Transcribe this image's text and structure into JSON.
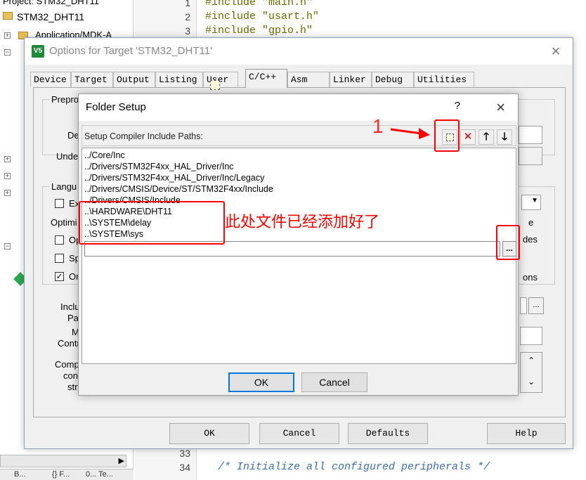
{
  "project": {
    "title": "Project: STM32_DHT11",
    "root": "STM32_DHT11",
    "group": "Application/MDK-A"
  },
  "editor": {
    "lines": [
      {
        "n": "1",
        "text": "#include \"main.h\""
      },
      {
        "n": "2",
        "text": "#include \"usart.h\""
      },
      {
        "n": "3",
        "text": "#include \"gpio.h\""
      }
    ],
    "bottom_lines": [
      {
        "n": "33",
        "text": ""
      },
      {
        "n": "34",
        "text": "  /* Initialize all configured peripherals */"
      }
    ]
  },
  "bottom_tabs": [
    "B...",
    "{} F...",
    "0... Te..."
  ],
  "options_dialog": {
    "icon": "V5",
    "title": "Options for Target 'STM32_DHT11'",
    "close": "×",
    "tabs": [
      "Device",
      "Target",
      "Output",
      "Listing",
      "User",
      "C/C++",
      "Asm",
      "Linker",
      "Debug",
      "Utilities"
    ],
    "active_tab": "C/C++",
    "bg_labels": {
      "preproc": "Prepro",
      "define": "Def",
      "undefine": "Undef",
      "language": "Langu",
      "ex": "Ex",
      "optim": "Optimi",
      "op": "Op",
      "sp": "Sp",
      "on": "On",
      "include": "Inclu",
      "paths": "Pat",
      "misc": "M",
      "controls": "Contr",
      "compiler": "Comp",
      "control": "con",
      "string": "stri",
      "right_des": "des",
      "right_ons": "ons",
      "right_e": "e"
    },
    "buttons": {
      "ok": "OK",
      "cancel": "Cancel",
      "defaults": "Defaults",
      "help": "Help"
    }
  },
  "folder_dialog": {
    "title": "Folder Setup",
    "help": "?",
    "close": "×",
    "header_label": "Setup Compiler Include Paths:",
    "paths": [
      "../Core/Inc",
      "../Drivers/STM32F4xx_HAL_Driver/Inc",
      "../Drivers/STM32F4xx_HAL_Driver/Inc/Legacy",
      "../Drivers/CMSIS/Device/ST/STM32F4xx/Include",
      "../Drivers/CMSIS/Include",
      "..\\HARDWARE\\DHT11",
      "..\\SYSTEM\\delay",
      "..\\SYSTEM\\sys"
    ],
    "edit_value": "",
    "browse": "...",
    "ok": "OK",
    "cancel": "Cancel"
  },
  "annotations": {
    "number": "1",
    "note": "此处文件已经添加好了",
    "color": "#ff0000"
  }
}
